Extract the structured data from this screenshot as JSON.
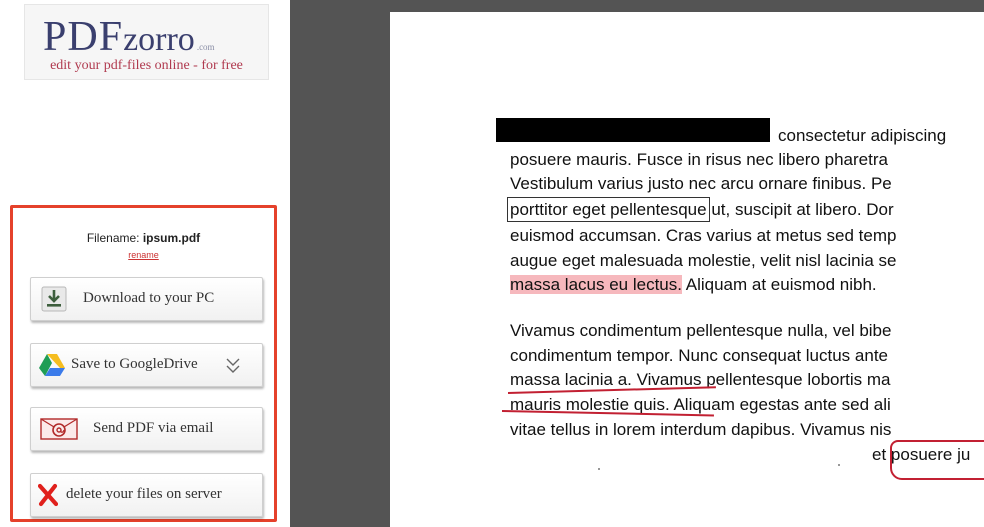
{
  "logo": {
    "brand_pdf": "PDF",
    "brand_zorro": "zorro",
    "brand_com": ".com",
    "tagline": "edit your pdf-files online - for free"
  },
  "file": {
    "filename_label": "Filename:",
    "filename": "ipsum.pdf",
    "rename_link": "rename"
  },
  "actions": {
    "download_label": "Download to your PC",
    "drive_label": "Save to GoogleDrive",
    "email_label": "Send PDF via email",
    "delete_label": "delete your files on server"
  },
  "document": {
    "para1": {
      "line1_after_redaction": "consectetur adipiscing",
      "line2": "posuere mauris. Fusce in risus nec libero pharetra",
      "line3": "Vestibulum varius justo nec arcu ornare finibus. Pe",
      "line4_boxed": "porttitor eget pellentesque",
      "line4_rest": " ut, suscipit at libero. Dor",
      "line5": "euismod accumsan. Cras varius at metus sed temp",
      "line6": "augue eget malesuada molestie, velit nisl lacinia se",
      "line7_highlight": "massa lacus eu lectus.",
      "line7_rest": " Aliquam at euismod nibh."
    },
    "para2": {
      "line1": "Vivamus condimentum pellentesque nulla, vel bibe",
      "line2": "condimentum tempor. Nunc consequat luctus ante",
      "line3": "massa lacinia a. Vivamus pellentesque lobortis ma",
      "line4_struck": "mauris molestie quis.",
      "line4_rest": " Aliquam egestas ante sed ali",
      "line5": "vitae tellus in lorem interdum dapibus. Vivamus nis",
      "line6_lead": "et ",
      "line6_circled": "posuere ju"
    }
  },
  "colors": {
    "panel_border": "#e5412b",
    "viewer_background": "#545454",
    "highlight": "#f6b8bd",
    "pen_annotation": "#c22032",
    "logo_text": "#3a3f6e",
    "tagline_text": "#b03a4f"
  },
  "icons": {
    "download": "download-arrow-icon",
    "drive": "google-drive-icon",
    "drive_menu": "chevron-double-down-icon",
    "email": "email-envelope-icon",
    "delete": "red-x-icon"
  }
}
